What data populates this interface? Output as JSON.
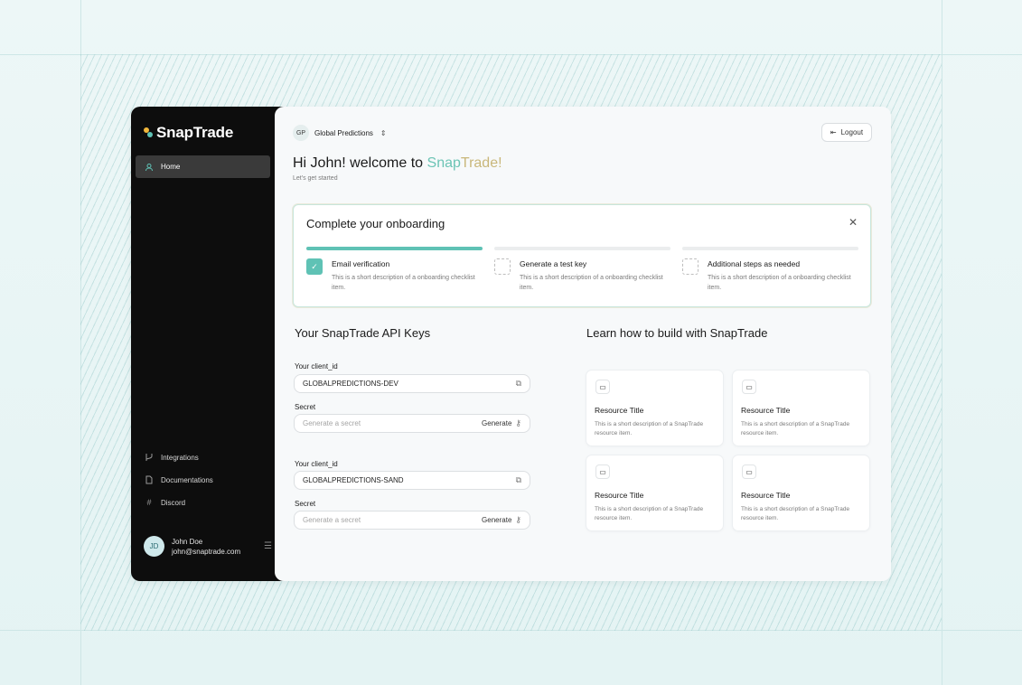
{
  "brand": {
    "name": "SnapTrade"
  },
  "sidebar": {
    "home": "Home",
    "items": [
      {
        "label": "Integrations",
        "icon": "branch-icon"
      },
      {
        "label": "Documentations",
        "icon": "document-icon"
      },
      {
        "label": "Discord",
        "icon": "hash-icon"
      }
    ],
    "user": {
      "initials": "JD",
      "name": "John Doe",
      "email": "john@snaptrade.com"
    }
  },
  "header": {
    "org_initials": "GP",
    "org_name": "Global Predictions",
    "logout": "Logout"
  },
  "welcome": {
    "prefix": "Hi John! welcome to ",
    "snap": "Snap",
    "trade": "Trade!",
    "subtitle": "Let's get started"
  },
  "onboarding": {
    "title": "Complete your onboarding",
    "steps": [
      {
        "title": "Email verification",
        "desc": "This is a short description of a  onboarding checklist item.",
        "done": true
      },
      {
        "title": "Generate a test key",
        "desc": "This is a short description of a  onboarding checklist item.",
        "done": false
      },
      {
        "title": "Additional steps as needed",
        "desc": "This is a short description of a  onboarding checklist item.",
        "done": false
      }
    ]
  },
  "api_keys": {
    "title": "Your SnapTrade API Keys",
    "client_label": "Your client_id",
    "secret_label": "Secret",
    "dev_client_id": "GLOBALPREDICTIONS-DEV",
    "sand_client_id": "GLOBALPREDICTIONS-SAND",
    "secret_placeholder": "Generate a secret",
    "generate": "Generate"
  },
  "learn": {
    "title": "Learn how to build with SnapTrade",
    "card_title": "Resource Title",
    "card_desc": "This is a short description of a SnapTrade resource item."
  },
  "colors": {
    "accent": "#5fc2b5",
    "sidebar": "#0d0d0d"
  }
}
